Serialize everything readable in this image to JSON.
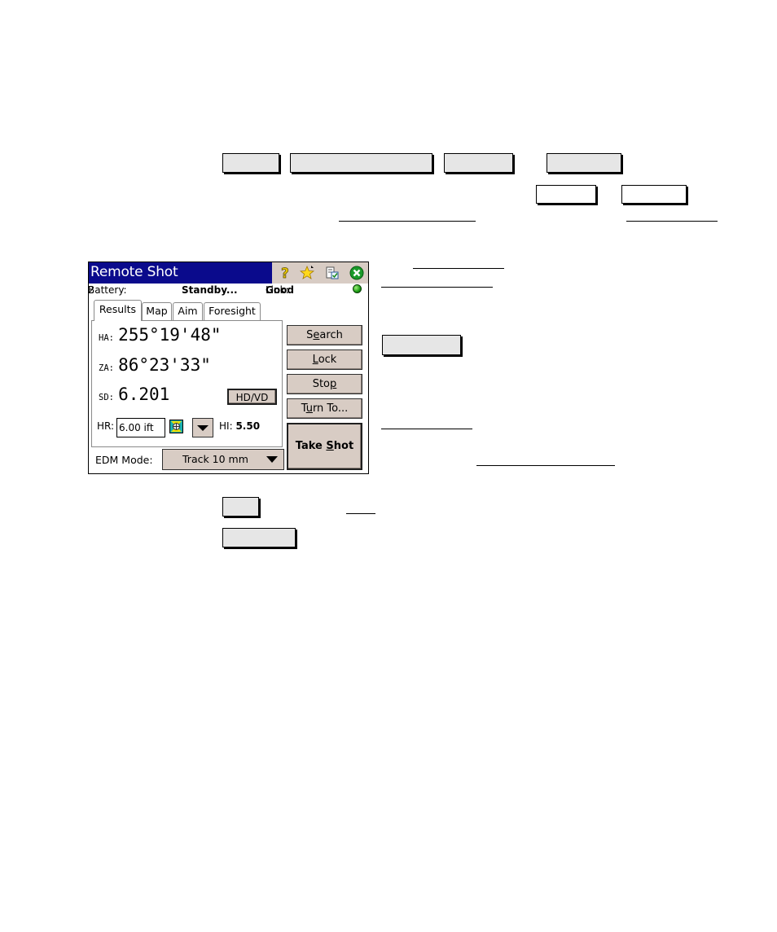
{
  "window": {
    "title": "Remote Shot",
    "icons": [
      "help-icon",
      "favorites-star-icon",
      "checklist-icon",
      "close-icon"
    ],
    "status": {
      "battery_label": "Battery:",
      "battery_value": "2",
      "state": "Standby...",
      "link_label": "Link:",
      "link_value": "Good",
      "link_indicator_color": "#1a9a12"
    },
    "tabs": [
      {
        "label": "Results",
        "active": true
      },
      {
        "label": "Map",
        "active": false
      },
      {
        "label": "Aim",
        "active": false
      },
      {
        "label": "Foresight",
        "active": false
      }
    ],
    "results": {
      "ha": {
        "label": "HA:",
        "value": "255°19'48\""
      },
      "za": {
        "label": "ZA:",
        "value": "86°23'33\""
      },
      "sd": {
        "label": "SD:",
        "value": "6.201"
      },
      "hdvd_button": "HD/VD",
      "hr_label": "HR:",
      "hr_value": "6.00 ift",
      "hi_label": "HI:",
      "hi_value": "5.50"
    },
    "side_buttons": [
      {
        "pre": "S",
        "accel": "e",
        "post": "arch"
      },
      {
        "pre": "",
        "accel": "L",
        "post": "ock"
      },
      {
        "pre": "Sto",
        "accel": "p",
        "post": ""
      },
      {
        "pre": "T",
        "accel": "u",
        "post": "rn To..."
      }
    ],
    "take_shot": {
      "pre": "Take ",
      "accel": "S",
      "post": "hot"
    },
    "edm_mode": {
      "label": "EDM Mode:",
      "value": "Track 10 mm"
    },
    "colors": {
      "titlebar": "#0a0a8c",
      "button_face": "#d8ccc4"
    }
  }
}
